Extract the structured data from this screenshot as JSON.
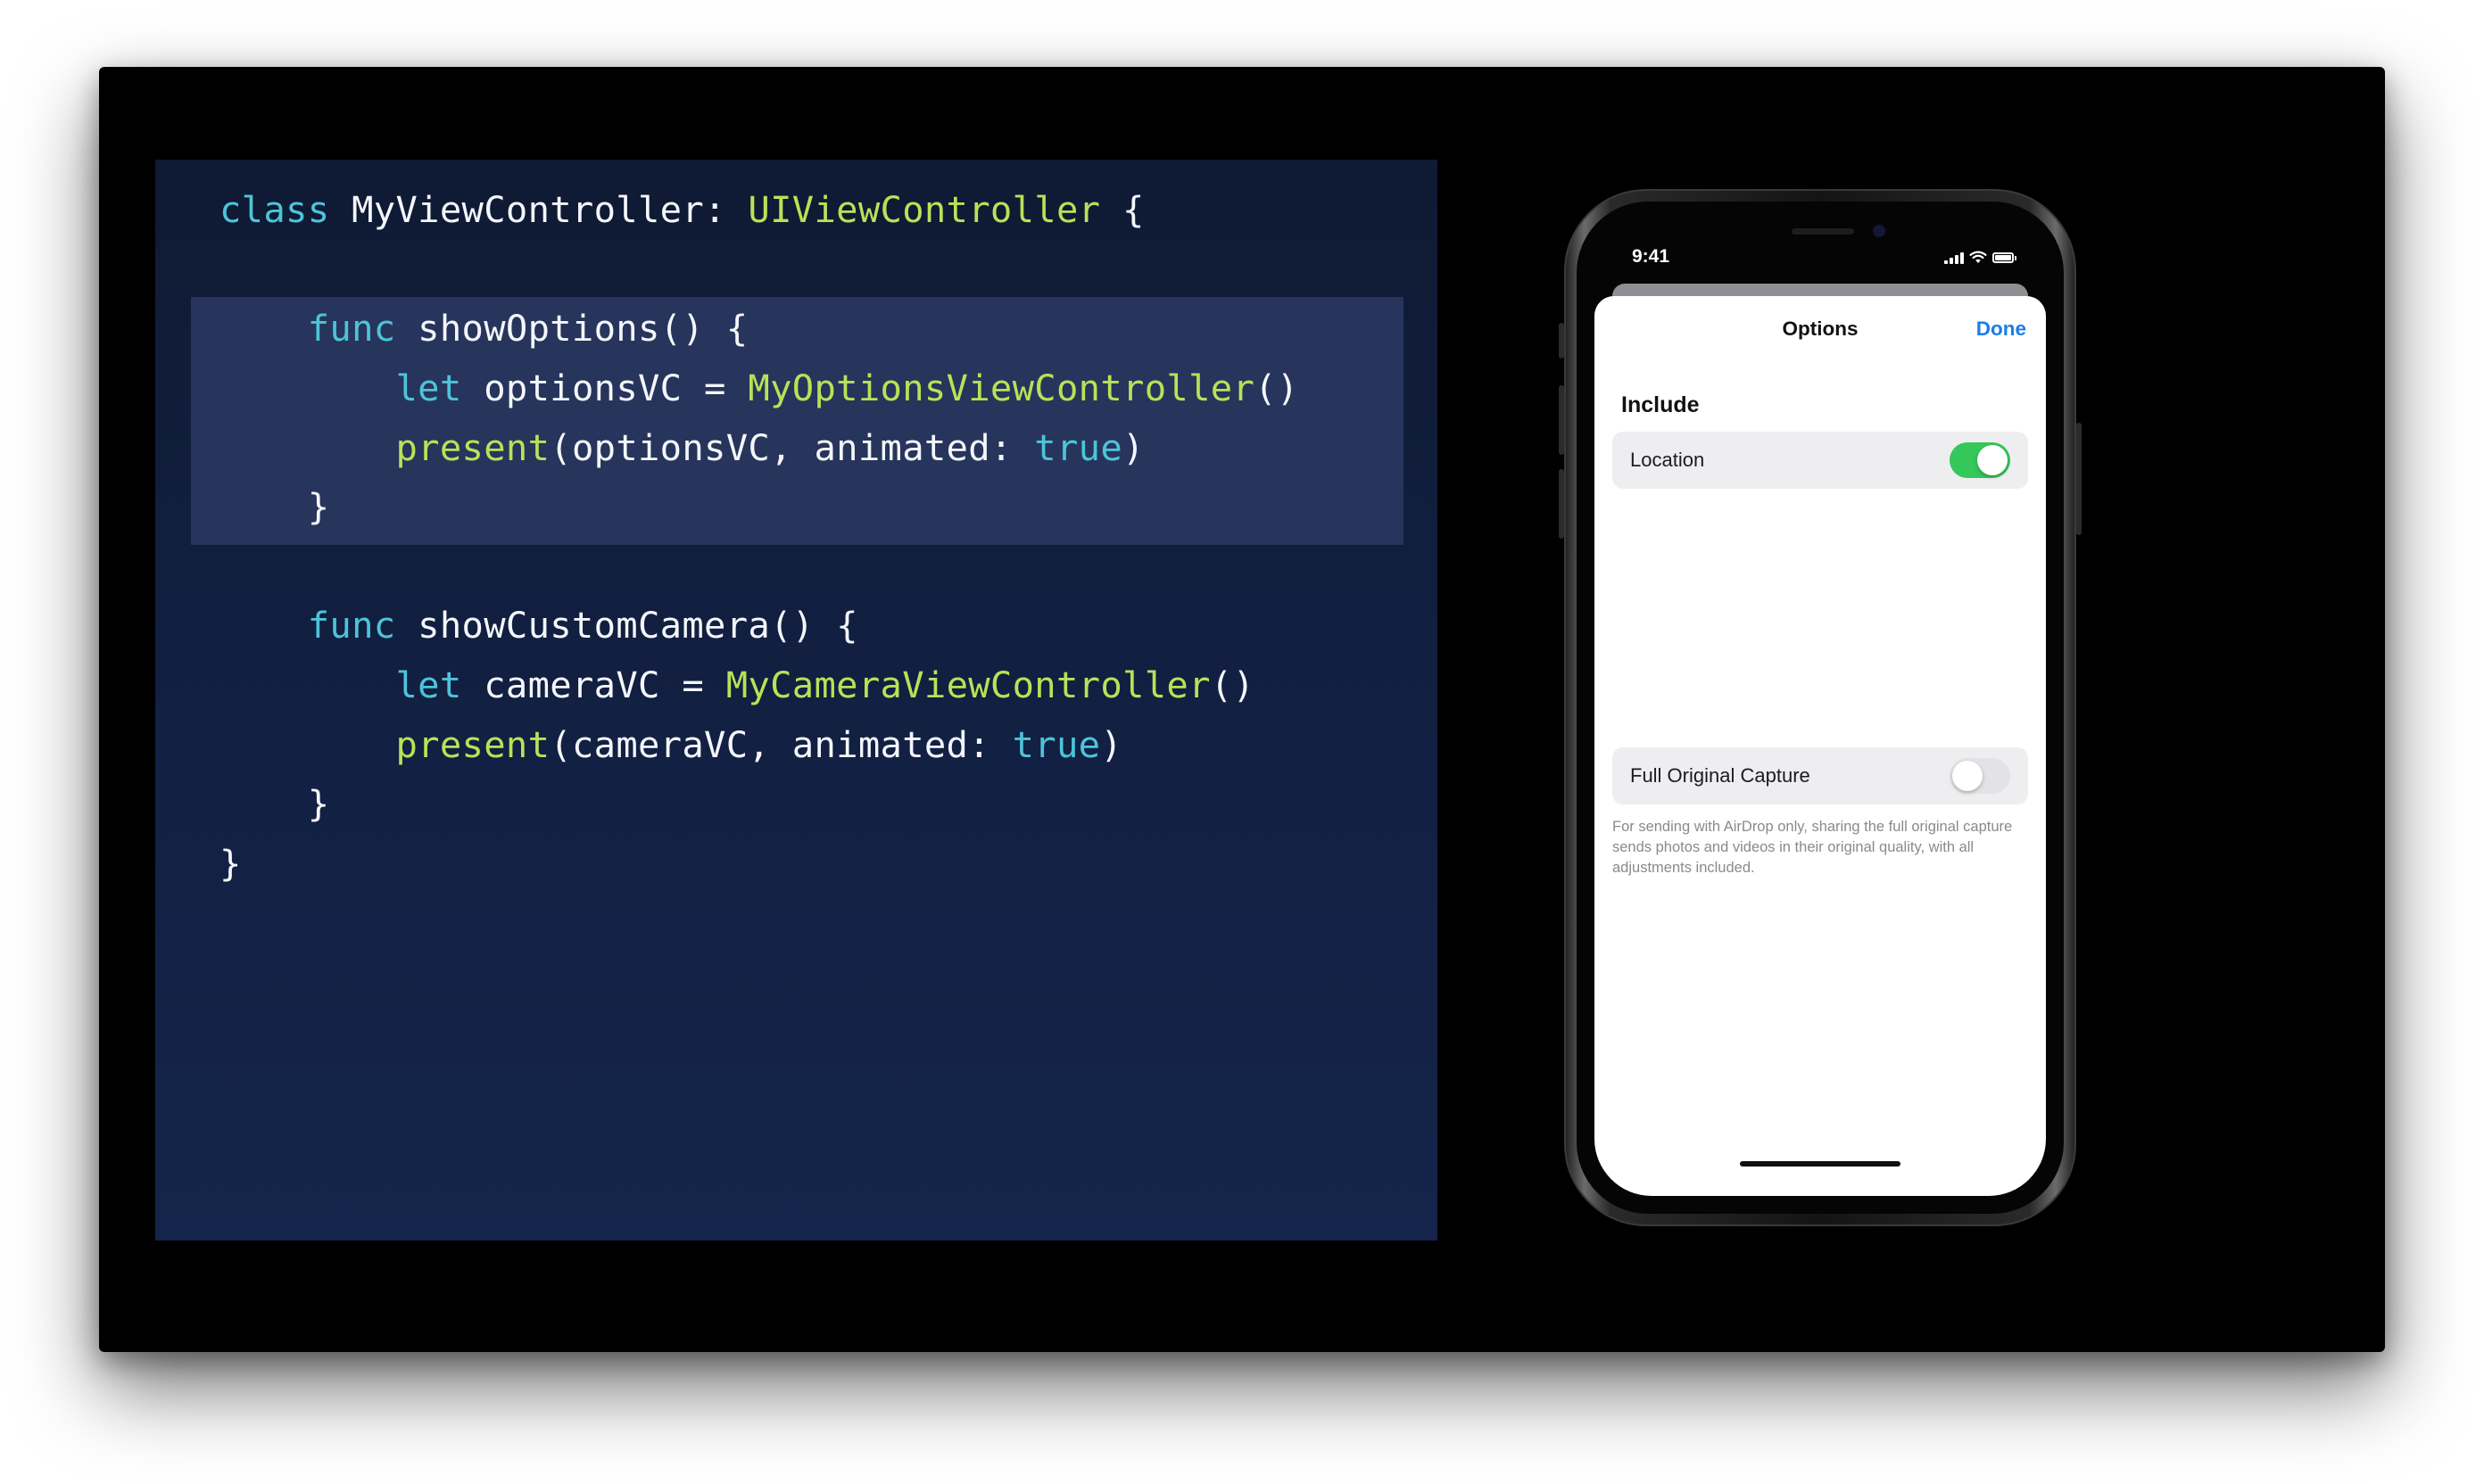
{
  "code": {
    "line1": {
      "kw": "class",
      "name": " MyViewController: ",
      "type": "UIViewController",
      "rest": " {"
    },
    "line2": {
      "indent": "    ",
      "kw": "func",
      "rest": " showOptions() {"
    },
    "line3": {
      "indent": "        ",
      "kw": "let",
      "mid": " optionsVC = ",
      "type": "MyOptionsViewController",
      "rest": "()"
    },
    "line4": {
      "indent": "        ",
      "fn": "present",
      "mid": "(optionsVC, animated: ",
      "lit": "true",
      "rest": ")"
    },
    "line5": {
      "text": "    }"
    },
    "line6": {
      "indent": "    ",
      "kw": "func",
      "rest": " showCustomCamera() {"
    },
    "line7": {
      "indent": "        ",
      "kw": "let",
      "mid": " cameraVC = ",
      "type": "MyCameraViewController",
      "rest": "()"
    },
    "line8": {
      "indent": "        ",
      "fn": "present",
      "mid": "(cameraVC, animated: ",
      "lit": "true",
      "rest": ")"
    },
    "line9": {
      "text": "    }"
    },
    "line10": {
      "text": "}"
    }
  },
  "phone": {
    "status_time": "9:41",
    "sheet_title": "Options",
    "done_label": "Done",
    "section_header": "Include",
    "location_label": "Location",
    "location_on": true,
    "capture_label": "Full Original Capture",
    "capture_on": false,
    "footer_text": "For sending with AirDrop only, sharing the full original capture sends photos and videos in their original quality, with all adjustments included."
  },
  "colors": {
    "keyword": "#4dc4d9",
    "type": "#b8e257",
    "toggle_on": "#34c759",
    "link": "#1a7de8"
  },
  "icons": [
    "signal-icon",
    "wifi-icon",
    "battery-icon"
  ]
}
